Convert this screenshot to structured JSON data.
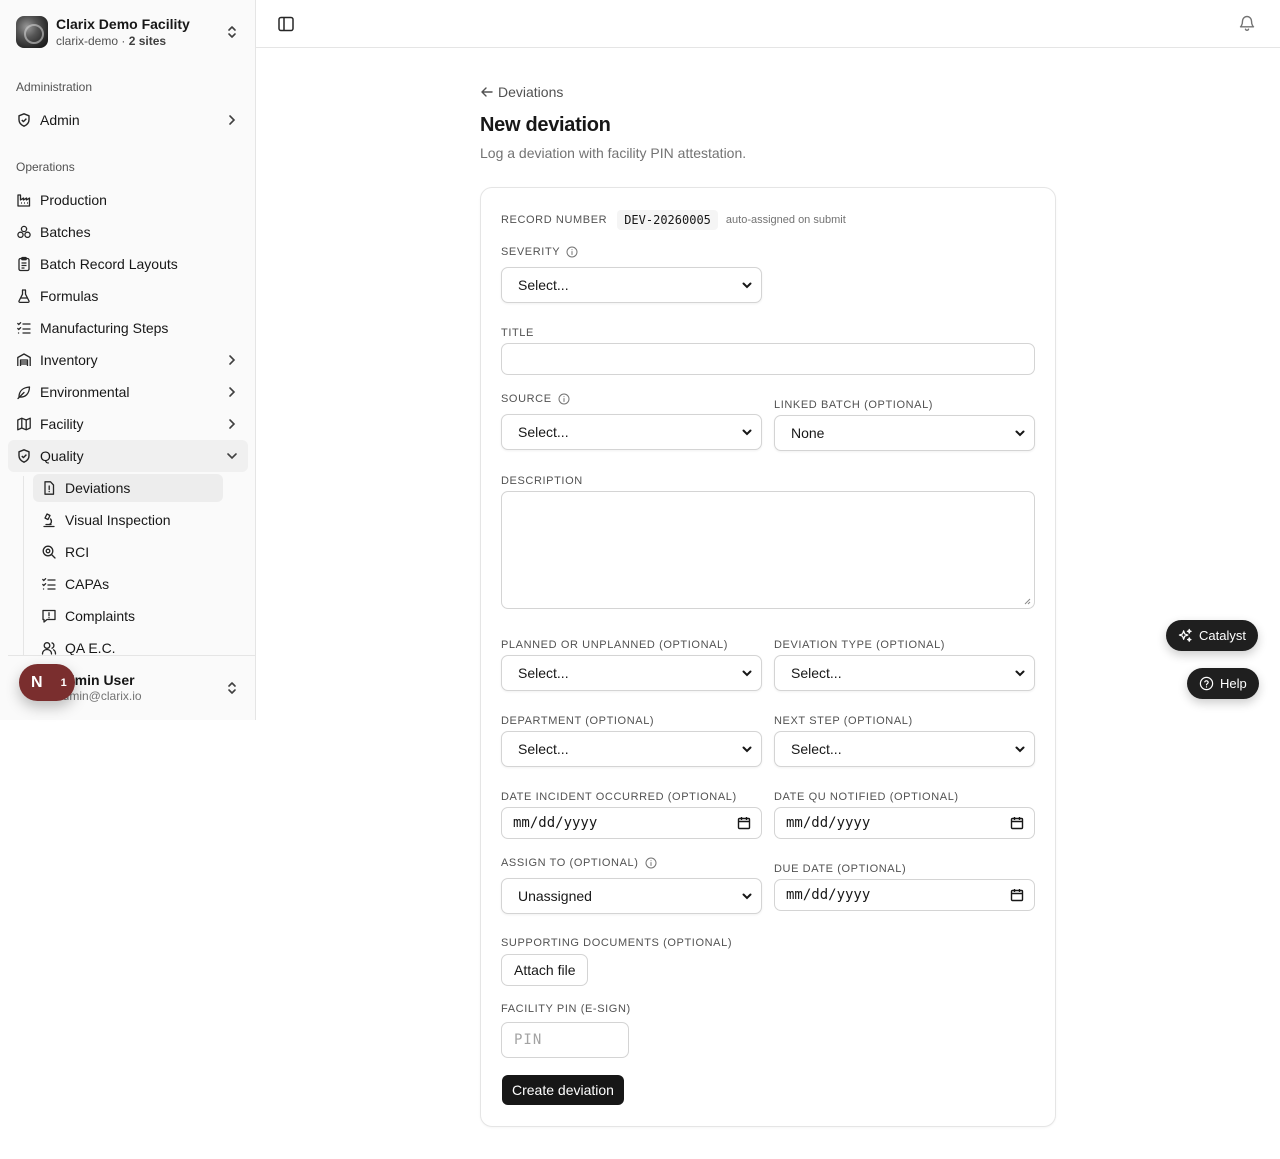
{
  "org": {
    "name": "Clarix Demo Facility",
    "slug": "clarix-demo",
    "sep": " · ",
    "sites": "2 sites"
  },
  "sidebar": {
    "administration_label": "Administration",
    "admin": "Admin",
    "operations_label": "Operations",
    "items": [
      {
        "label": "Production",
        "icon": "factory-icon"
      },
      {
        "label": "Batches",
        "icon": "cubes-icon"
      },
      {
        "label": "Batch Record Layouts",
        "icon": "clipboard-icon"
      },
      {
        "label": "Formulas",
        "icon": "flask-icon"
      },
      {
        "label": "Manufacturing Steps",
        "icon": "list-checks-icon"
      },
      {
        "label": "Inventory",
        "icon": "warehouse-icon"
      },
      {
        "label": "Environmental",
        "icon": "leaf-icon"
      },
      {
        "label": "Facility",
        "icon": "map-icon"
      },
      {
        "label": "Quality",
        "icon": "shield-check-icon"
      }
    ],
    "quality_sub": [
      {
        "label": "Deviations",
        "icon": "file-alert-icon"
      },
      {
        "label": "Visual Inspection",
        "icon": "microscope-icon"
      },
      {
        "label": "RCI",
        "icon": "search-zoom-icon"
      },
      {
        "label": "CAPAs",
        "icon": "list-checks-icon"
      },
      {
        "label": "Complaints",
        "icon": "message-alert-icon"
      },
      {
        "label": "QA E.C.",
        "icon": "users-icon"
      }
    ],
    "user": {
      "name": "Admin User",
      "email": "admin@clarix.io"
    },
    "fab": {
      "letter": "N",
      "count": "1"
    }
  },
  "page": {
    "back": "Deviations",
    "title": "New deviation",
    "subtitle": "Log a deviation with facility PIN attestation."
  },
  "form": {
    "record_number_label": "RECORD NUMBER",
    "record_number": "DEV-20260005",
    "record_hint": "auto-assigned on submit",
    "severity_label": "SEVERITY",
    "severity_value": "Select...",
    "title_label": "TITLE",
    "title_value": "",
    "source_label": "SOURCE",
    "source_value": "Select...",
    "linked_batch_label": "LINKED BATCH (OPTIONAL)",
    "linked_batch_value": "None",
    "description_label": "DESCRIPTION",
    "planned_label": "PLANNED OR UNPLANNED (OPTIONAL)",
    "planned_value": "Select...",
    "deviation_type_label": "DEVIATION TYPE (OPTIONAL)",
    "deviation_type_value": "Select...",
    "department_label": "DEPARTMENT (OPTIONAL)",
    "department_value": "Select...",
    "next_step_label": "NEXT STEP (OPTIONAL)",
    "next_step_value": "Select...",
    "date_incident_label": "DATE INCIDENT OCCURRED (OPTIONAL)",
    "date_incident_value": "mm/dd/yyyy",
    "date_qu_label": "DATE QU NOTIFIED (OPTIONAL)",
    "date_qu_value": "mm/dd/yyyy",
    "assign_label": "ASSIGN TO (OPTIONAL)",
    "assign_value": "Unassigned",
    "due_label": "DUE DATE (OPTIONAL)",
    "due_value": "mm/dd/yyyy",
    "docs_label": "SUPPORTING DOCUMENTS (OPTIONAL)",
    "attach_label": "Attach file",
    "pin_label": "FACILITY PIN (E-SIGN)",
    "pin_placeholder": "PIN",
    "submit_label": "Create deviation"
  },
  "floating": {
    "catalyst": "Catalyst",
    "help": "Help"
  },
  "colors": {
    "primary": "#171717",
    "avatar": "#7a2e2e",
    "border": "#e5e5e5"
  }
}
